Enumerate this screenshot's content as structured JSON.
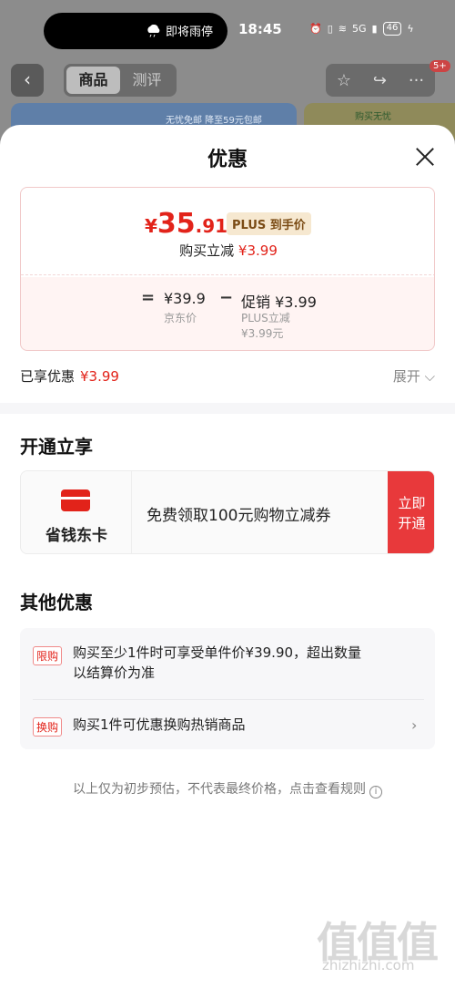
{
  "status_bar": {
    "weather_text": "即将雨停",
    "time": "18:45",
    "network": "5G",
    "battery": "46"
  },
  "nav": {
    "back_icon": "chevron-left-icon",
    "tabs": [
      {
        "label": "商品",
        "active": true
      },
      {
        "label": "测评",
        "active": false
      }
    ],
    "actions": [
      "star-icon",
      "share-icon",
      "more-icon"
    ],
    "badge": "5+"
  },
  "banners": {
    "left_tag": "无忧免邮  降至59元包邮",
    "right_tag": "购买无忧"
  },
  "sheet": {
    "title": "优惠",
    "price": {
      "symbol": "¥",
      "integer": "35",
      "decimal": ".91",
      "plus_tag": "PLUS 到手价",
      "reduce_label": "购买立减",
      "reduce_value": "¥3.99",
      "equals": "=",
      "jd_price": "¥39.9",
      "jd_price_label": "京东价",
      "minus": "−",
      "promo_value": "促销 ¥3.99",
      "promo_sub1": "PLUS立减",
      "promo_sub2": "¥3.99元"
    },
    "enjoyed": {
      "label": "已享优惠",
      "value": "¥3.99",
      "expand": "展开 ⌵"
    },
    "open_section": {
      "title": "开通立享",
      "card_name": "省钱东卡",
      "description": "免费领取100元购物立减券",
      "button_line1": "立即",
      "button_line2": "开通"
    },
    "other_section": {
      "title": "其他优惠",
      "items": [
        {
          "tag": "限购",
          "text_line1": "购买至少1件时可享受单件价¥39.90，超出数量",
          "text_line2": "以结算价为准"
        },
        {
          "tag": "换购",
          "text_line1": "购买1件可优惠换购热销商品"
        }
      ]
    },
    "note": "以上仅为初步预估，不代表最终价格，点击查看规则",
    "watermark": "值值值",
    "watermark_url": "zhizhizhi.com"
  },
  "colors": {
    "accent_red": "#e2231a",
    "button_red": "#e8393b",
    "plus_gold": "#f6e8d0"
  }
}
